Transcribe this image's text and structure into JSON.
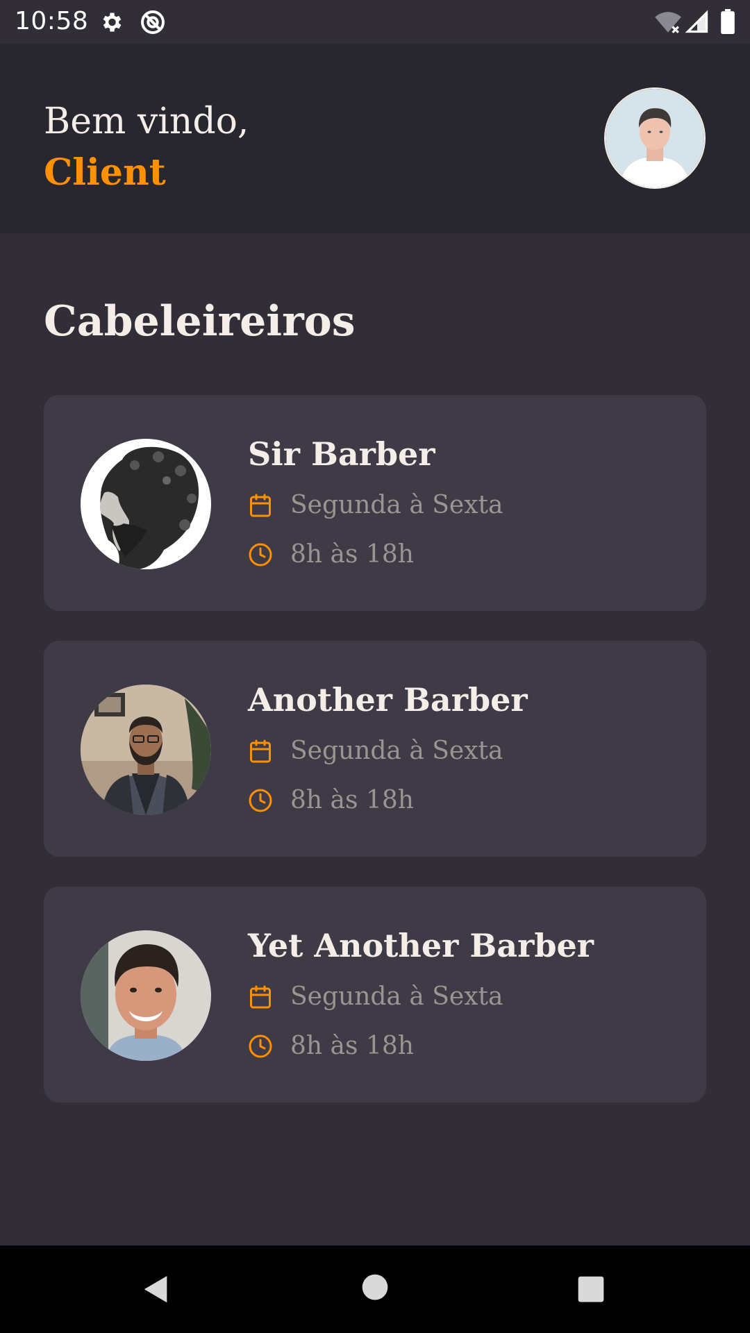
{
  "status_bar": {
    "time": "10:58",
    "icons": [
      "gear-icon",
      "sync-off-icon",
      "wifi-off-icon",
      "signal-icon",
      "battery-icon"
    ]
  },
  "header": {
    "greeting": "Bem vindo,",
    "user_name": "Client",
    "avatar_icon": "profile-avatar"
  },
  "section": {
    "title": "Cabeleireiros"
  },
  "providers": [
    {
      "name": "Sir Barber",
      "days": "Segunda à Sexta",
      "hours": "8h às 18h"
    },
    {
      "name": "Another Barber",
      "days": "Segunda à Sexta",
      "hours": "8h às 18h"
    },
    {
      "name": "Yet Another Barber",
      "days": "Segunda à Sexta",
      "hours": "8h às 18h"
    }
  ],
  "colors": {
    "background": "#312e38",
    "header_background": "#28262e",
    "card_background": "#3e3b47",
    "accent": "#ff9000",
    "text": "#f4ede8",
    "muted_text": "#999591"
  },
  "nav_bar": {
    "icons": [
      "back-icon",
      "home-icon",
      "recent-apps-icon"
    ]
  }
}
